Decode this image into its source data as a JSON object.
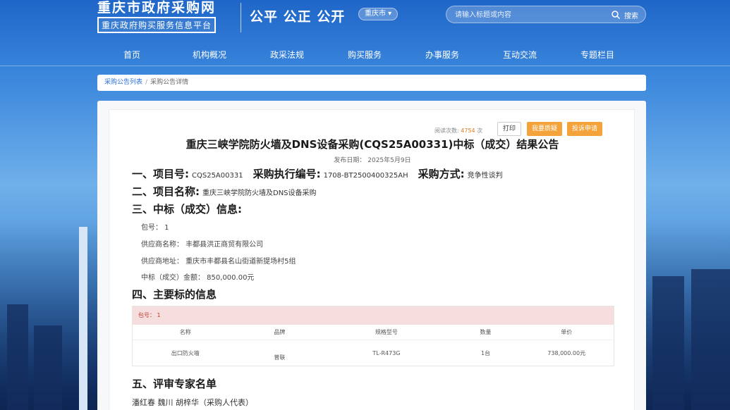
{
  "header": {
    "logo_title": "重庆市政府采购网",
    "logo_subtitle": "重庆政府购买服务信息平台",
    "slogan": "公平 公正 公开",
    "region": "重庆市 ▾",
    "search_placeholder": "请输入标题或内容",
    "search_button": "搜索"
  },
  "nav": [
    "首页",
    "机构概况",
    "政采法规",
    "购买服务",
    "办事服务",
    "互动交流",
    "专题栏目"
  ],
  "breadcrumb": {
    "parent": "采购公告列表",
    "current": "采购公告详情"
  },
  "toolbar": {
    "views_label": "阅读次数:",
    "views_count": "4754",
    "views_unit": "次",
    "print": "打印",
    "question": "我要质疑",
    "appeal": "投诉申请"
  },
  "notice": {
    "title": "重庆三峡学院防火墙及DNS设备采购(CQS25A00331)中标（成交）结果公告",
    "pub_date": "发布日期： 2025年5月9日",
    "s1_label": "一、项目号:",
    "s1_value": "CQS25A00331",
    "s1_exec_label": "采购执行编号:",
    "s1_exec_value": "1708-BT2500400325AH",
    "s1_method_label": "采购方式:",
    "s1_method_value": "竞争性谈判",
    "s2_label": "二、项目名称:",
    "s2_value": "重庆三峡学院防火墙及DNS设备采购",
    "s3_label": "三、中标（成交）信息:",
    "package": "包号： 1",
    "supplier_name": "供应商名称： 丰都县洪正商贸有限公司",
    "supplier_addr": "供应商地址： 重庆市丰都县名山街道新提场村5组",
    "amount": "中标（成交）金额： 850,000.00元",
    "s4_label": "四、主要标的信息",
    "s5_label": "五、评审专家名单",
    "experts": "潘红春 魏川 胡梓华（采购人代表）"
  },
  "table": {
    "package": "包号： 1",
    "headers": [
      "名称",
      "品牌",
      "规格型号",
      "数量",
      "单价"
    ],
    "rows": [
      [
        "出口防火墙",
        "普联",
        "TL-R473G",
        "1台",
        "738,000.00元"
      ]
    ]
  },
  "colors": {
    "accent": "#f4a23a",
    "link": "#2a6fd6",
    "table_pkg_bg": "#f6dede"
  }
}
